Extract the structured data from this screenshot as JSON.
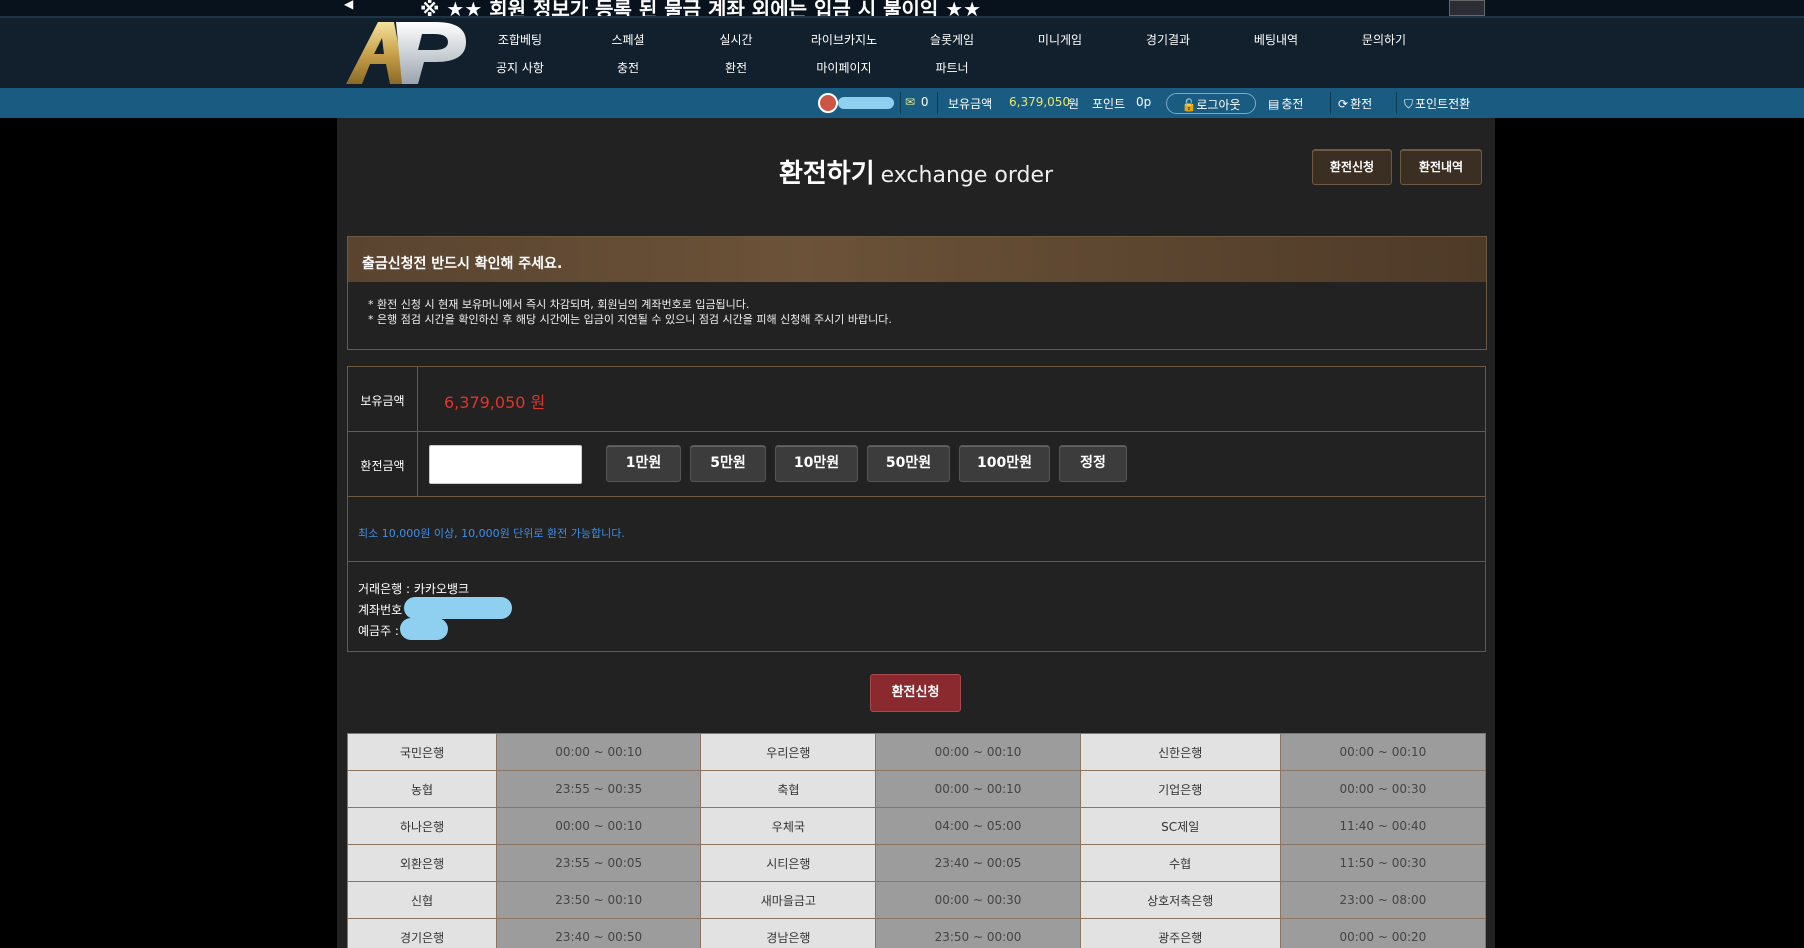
{
  "ticker": {
    "text": "※ ★★ 회원 정보가 등록 된 물금 계좌 외에는 입금 시 불이익 ★★"
  },
  "logo": {
    "text": "AP"
  },
  "nav": {
    "row1": [
      "조합베팅",
      "스페셜",
      "실시간",
      "라이브카지노",
      "슬롯게임",
      "미니게임",
      "경기결과",
      "베팅내역",
      "문의하기"
    ],
    "row2": [
      "공지 사항",
      "충전",
      "환전",
      "마이페이지",
      "파트너"
    ]
  },
  "userbar": {
    "messages": "0",
    "balance_label": "보유금액",
    "balance_value": "6,379,050",
    "balance_unit": "원",
    "point_label": "포인트",
    "point_value": "0p",
    "logout": "로그아웃",
    "charge": "충전",
    "exchange": "환전",
    "point_convert": "포인트전환"
  },
  "page": {
    "title_ko": "환전하기",
    "title_en": "exchange order",
    "btn_apply": "환전신청",
    "btn_history": "환전내역"
  },
  "notice": {
    "heading": "출금신청전 반드시 확인해 주세요.",
    "lines": [
      "* 환전 신청 시 현재 보유머니에서 즉시 차감되며, 회원님의 계좌번호로 입금됩니다.",
      "* 은행 점검 시간을 확인하신 후 해당 시간에는 입금이 지연될 수 있으니 점검 시간을 피해 신청해 주시기 바랍니다."
    ]
  },
  "form": {
    "balance_label": "보유금액",
    "balance_value": "6,379,050 원",
    "amount_label": "환전금액",
    "amount_value": "",
    "amount_buttons": [
      "1만원",
      "5만원",
      "10만원",
      "50만원",
      "100만원",
      "정정"
    ],
    "hint": "최소 10,000원 이상, 10,000원  단위로 환전 가능합니다.",
    "bank_line": "거래은행 : 카카오뱅크",
    "account_line": "계좌번호 :",
    "holder_line": "예금주 :"
  },
  "submit": "환전신청",
  "bank_hours": [
    [
      "국민은행",
      "00:00 ~ 00:10",
      "우리은행",
      "00:00 ~ 00:10",
      "신한은행",
      "00:00 ~ 00:10"
    ],
    [
      "농협",
      "23:55 ~ 00:35",
      "축협",
      "00:00 ~ 00:10",
      "기업은행",
      "00:00 ~ 00:30"
    ],
    [
      "하나은행",
      "00:00 ~ 00:10",
      "우체국",
      "04:00 ~ 05:00",
      "SC제일",
      "11:40 ~ 00:40"
    ],
    [
      "외환은행",
      "23:55 ~ 00:05",
      "시티은행",
      "23:40 ~ 00:05",
      "수협",
      "11:50 ~ 00:30"
    ],
    [
      "신협",
      "23:50 ~ 00:10",
      "새마을금고",
      "00:00 ~ 00:30",
      "상호저축은행",
      "23:00 ~ 08:00"
    ],
    [
      "경기은행",
      "23:40 ~ 00:50",
      "경남은행",
      "23:50 ~ 00:00",
      "광주은행",
      "00:00 ~ 00:20"
    ]
  ],
  "colors": {
    "accent_red": "#e3332a",
    "hint_blue": "#3d8ee8",
    "brown_border": "#6b5a40",
    "bar_blue": "#1a5b82"
  }
}
